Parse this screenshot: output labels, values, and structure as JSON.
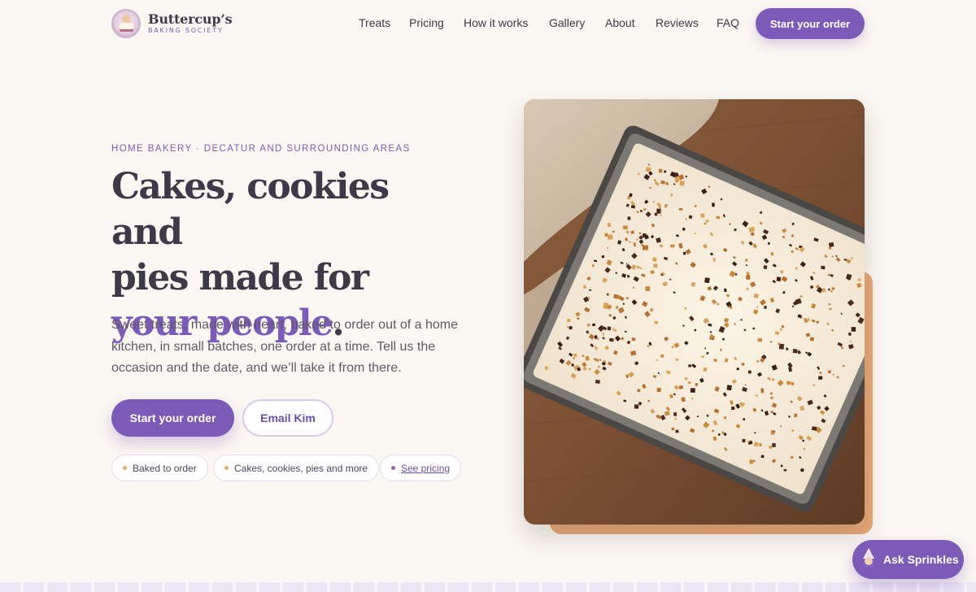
{
  "brand": {
    "name": "Buttercup’s",
    "tagline": "BAKING SOCIETY"
  },
  "nav": {
    "items": [
      "Treats",
      "Pricing",
      "How it works",
      "Gallery",
      "About",
      "Reviews",
      "FAQ"
    ],
    "cta": "Start your order"
  },
  "hero": {
    "eyebrow": "HOME BAKERY · DECATUR AND SURROUNDING AREAS",
    "headline_line1": "Cakes, cookies and",
    "headline_line2": "pies made for",
    "headline_accent": "your people",
    "headline_period": ".",
    "lede": "Sweet treats, made with heart, baked to order out of a home kitchen, in small batches, one order at a time. Tell us the occasion and the date, and we’ll take it from there.",
    "primary_cta": "Start your order",
    "secondary_cta": "Email Kim",
    "chips": [
      "Baked to order",
      "Cakes, cookies, pies and more",
      "See pricing"
    ]
  },
  "colors": {
    "accent": "#7c5bb8",
    "background": "#fbf7f2",
    "peach": "#e6a979"
  },
  "chat": {
    "label": "Ask Sprinkles",
    "icon": "gnome-icon"
  }
}
